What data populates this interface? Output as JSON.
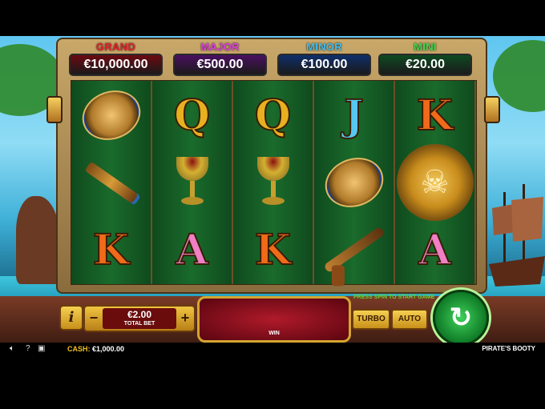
{
  "jackpots": [
    {
      "name": "GRAND",
      "value": "€10,000.00",
      "name_color": "#e8202a",
      "box_color": "#6a0a12"
    },
    {
      "name": "MAJOR",
      "value": "€500.00",
      "name_color": "#e040e0",
      "box_color": "#4a1060"
    },
    {
      "name": "MINOR",
      "value": "€100.00",
      "name_color": "#3fbff0",
      "box_color": "#0f2f6a"
    },
    {
      "name": "MINI",
      "value": "€20.00",
      "name_color": "#40d84a",
      "box_color": "#0e4a22"
    }
  ],
  "reels": [
    [
      "compass",
      "spyglass",
      "K"
    ],
    [
      "Q",
      "chalice",
      "A"
    ],
    [
      "Q",
      "chalice",
      "K"
    ],
    [
      "J",
      "compass",
      "pistol"
    ],
    [
      "K",
      "skull",
      "A"
    ]
  ],
  "controls": {
    "info_label": "i",
    "bet_minus": "−",
    "bet_plus": "+",
    "bet_value": "€2.00",
    "bet_label": "TOTAL BET",
    "win_label": "WIN",
    "press_message": "PRESS SPIN TO START GAME",
    "turbo_label": "TURBO",
    "auto_label": "AUTO",
    "spin_icon": "↻"
  },
  "status": {
    "cash_label": "CASH:",
    "cash_value": "€1,000.00",
    "game_name": "PIRATE'S BOOTY",
    "sound_icon": "speaker-icon",
    "help_icon": "question-icon",
    "fullscreen_icon": "fullscreen-icon"
  }
}
